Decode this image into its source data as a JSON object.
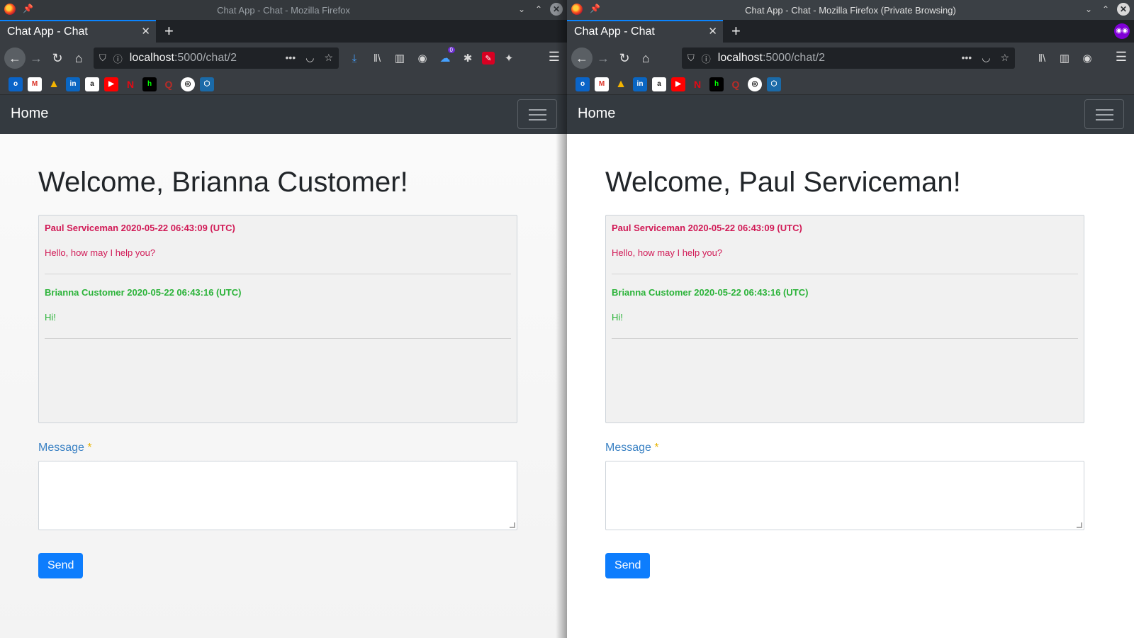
{
  "windows": {
    "left": {
      "window_title": "Chat App - Chat - Mozilla Firefox",
      "tab_label": "Chat App - Chat",
      "url_host": "localhost",
      "url_rest": ":5000/chat/2",
      "extension_badge": "0",
      "welcome": "Welcome, Brianna Customer!"
    },
    "right": {
      "window_title": "Chat App - Chat - Mozilla Firefox (Private Browsing)",
      "tab_label": "Chat App - Chat",
      "url_host": "localhost",
      "url_rest": ":5000/chat/2",
      "welcome": "Welcome, Paul Serviceman!"
    }
  },
  "site": {
    "brand": "Home",
    "message_label": "Message",
    "required_mark": "*",
    "send_label": "Send"
  },
  "messages": [
    {
      "header": "Paul Serviceman 2020-05-22 06:43:09 (UTC)",
      "text": "Hello, how may I help you?",
      "color": "#d11a56"
    },
    {
      "header": "Brianna Customer 2020-05-22 06:43:16 (UTC)",
      "text": "Hi!",
      "color": "#2bb339"
    }
  ],
  "icons": {
    "window": [
      "firefox-logo-icon",
      "pin-icon",
      "minimize-icon",
      "maximize-icon",
      "close-icon"
    ],
    "nav": [
      "back-icon",
      "forward-icon",
      "reload-icon",
      "home-icon"
    ],
    "bookmarks": [
      "outlook",
      "gmail",
      "google-drive",
      "linkedin",
      "amazon",
      "youtube",
      "netflix",
      "hackernoon",
      "quora",
      "github",
      "codepen"
    ]
  },
  "accent_color": "#0d7dfd"
}
